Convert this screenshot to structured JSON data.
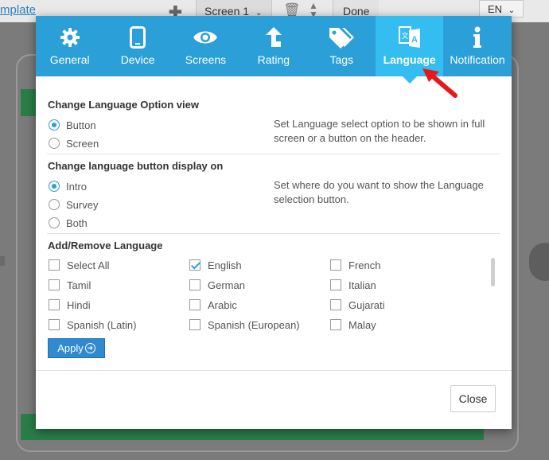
{
  "background": {
    "template_link": "mplate",
    "screen_select": "Screen 1",
    "done_label": "Done",
    "lang_select": "EN"
  },
  "tabs": [
    {
      "label": "General",
      "icon": "gear-icon"
    },
    {
      "label": "Device",
      "icon": "tablet-icon"
    },
    {
      "label": "Screens",
      "icon": "eye-icon"
    },
    {
      "label": "Rating",
      "icon": "arrow-up-icon"
    },
    {
      "label": "Tags",
      "icon": "tags-icon"
    },
    {
      "label": "Language",
      "icon": "translate-icon",
      "active": true
    },
    {
      "label": "Notification",
      "icon": "info-icon"
    }
  ],
  "option_view": {
    "title": "Change Language Option view",
    "options": [
      {
        "label": "Button",
        "checked": true
      },
      {
        "label": "Screen",
        "checked": false
      }
    ],
    "description": "Set Language select option to be shown in full screen or a button on the header."
  },
  "button_display": {
    "title": "Change language button display on",
    "options": [
      {
        "label": "Intro",
        "checked": true
      },
      {
        "label": "Survey",
        "checked": false
      },
      {
        "label": "Both",
        "checked": false
      }
    ],
    "description": "Set where do you want to show the Language selection button."
  },
  "languages": {
    "title": "Add/Remove Language",
    "items": [
      {
        "label": "Select All",
        "checked": false
      },
      {
        "label": "English",
        "checked": true
      },
      {
        "label": "French",
        "checked": false
      },
      {
        "label": "Tamil",
        "checked": false
      },
      {
        "label": "German",
        "checked": false
      },
      {
        "label": "Italian",
        "checked": false
      },
      {
        "label": "Hindi",
        "checked": false
      },
      {
        "label": "Arabic",
        "checked": false
      },
      {
        "label": "Gujarati",
        "checked": false
      },
      {
        "label": "Spanish (Latin)",
        "checked": false
      },
      {
        "label": "Spanish (European)",
        "checked": false
      },
      {
        "label": "Malay",
        "checked": false
      }
    ],
    "apply_label": "Apply"
  },
  "footer": {
    "close_label": "Close"
  },
  "colors": {
    "tab_bar": "#2a9fd8",
    "tab_active": "#34bdf0",
    "accent": "#2a9fd8",
    "apply_button": "#2f8ad0",
    "annotation_arrow": "#e3191c"
  }
}
